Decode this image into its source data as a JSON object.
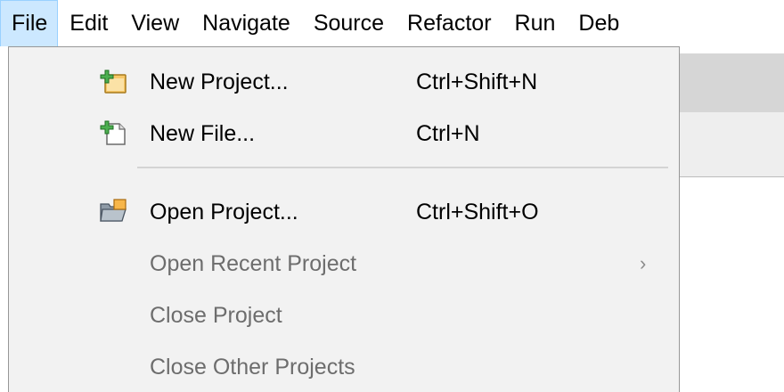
{
  "menubar": {
    "items": [
      {
        "label": "File",
        "active": true
      },
      {
        "label": "Edit"
      },
      {
        "label": "View"
      },
      {
        "label": "Navigate"
      },
      {
        "label": "Source"
      },
      {
        "label": "Refactor"
      },
      {
        "label": "Run"
      },
      {
        "label": "Deb"
      }
    ]
  },
  "file_menu": {
    "items": [
      {
        "label": "New Project...",
        "shortcut": "Ctrl+Shift+N",
        "icon": "new-project-icon",
        "enabled": true
      },
      {
        "label": "New File...",
        "shortcut": "Ctrl+N",
        "icon": "new-file-icon",
        "enabled": true
      },
      {
        "label": "Open Project...",
        "shortcut": "Ctrl+Shift+O",
        "icon": "open-project-icon",
        "enabled": true
      },
      {
        "label": "Open Recent Project",
        "submenu": true,
        "enabled": false
      },
      {
        "label": "Close Project",
        "enabled": false
      },
      {
        "label": "Close Other Projects",
        "enabled": false
      }
    ]
  },
  "colors": {
    "active_menu_bg": "#cce8ff",
    "active_menu_border": "#99d1ff",
    "dropdown_bg": "#f2f2f2",
    "disabled_text": "#6d6d6d"
  },
  "icons": {
    "submenu_arrow": "chevron-right-icon"
  }
}
